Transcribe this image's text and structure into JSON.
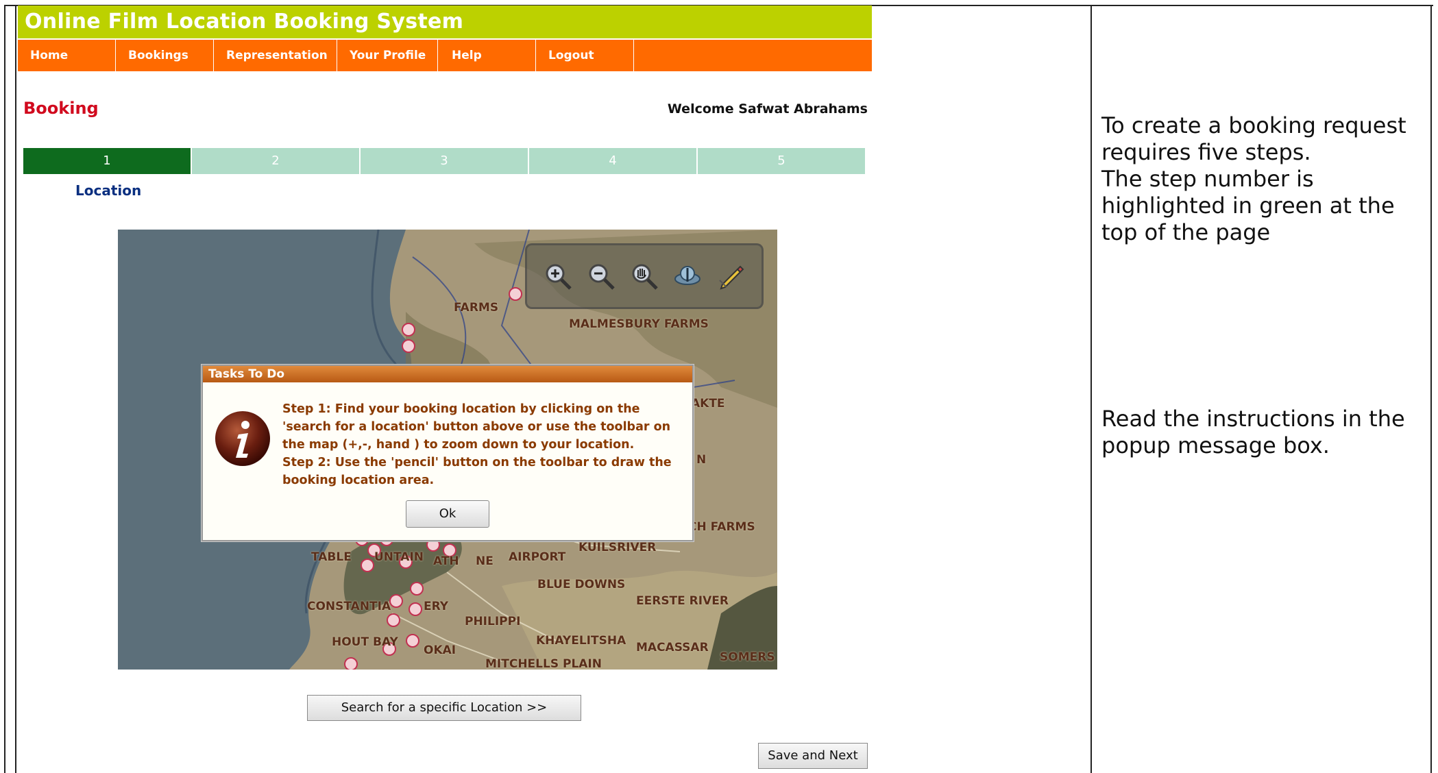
{
  "app": {
    "title": "Online Film Location Booking System",
    "nav": [
      "Home",
      "Bookings",
      "Representation",
      "Your Profile",
      "Help",
      "Logout"
    ],
    "page_heading": "Booking",
    "welcome": "Welcome Safwat Abrahams",
    "steps": [
      "1",
      "2",
      "3",
      "4",
      "5"
    ],
    "active_step": "1",
    "step_label": "Location"
  },
  "map": {
    "toolbar_icons": [
      "zoom-in-icon",
      "zoom-out-icon",
      "pan-hand-icon",
      "full-extent-globe-icon",
      "pencil-draw-icon"
    ],
    "labels": [
      "FARMS",
      "MALMESBURY FARMS",
      "AKTE",
      "N",
      "CH FARMS",
      "KUILSRIVER",
      "TABLE",
      "UNTAIN",
      "ATH",
      "NE",
      "AIRPORT",
      "BLUE DOWNS",
      "CONSTANTIA",
      "ERY",
      "EERSTE RIVER",
      "PHILIPPI",
      "KHAYELITSHA",
      "MACASSAR",
      "HOUT BAY",
      "OKAI",
      "MITCHELLS PLAIN",
      "SOMERS"
    ]
  },
  "popup": {
    "title": "Tasks To Do",
    "message_lines": [
      "Step 1: Find your booking location by clicking on the",
      "'search for a location' button above or use the toolbar on",
      "the map (+,-, hand ) to zoom down to your location.",
      "Step 2: Use the 'pencil' button on the toolbar to draw the",
      "booking location area."
    ],
    "ok_label": "Ok"
  },
  "buttons": {
    "search_label": "Search for a specific Location >>",
    "save_label": "Save and Next"
  },
  "notes": {
    "note1": "To create a booking request requires five steps.\nThe step number is highlighted in green at the top of the page",
    "note2": "Read the instructions in the popup message box."
  },
  "colors": {
    "title_bar": "#bcd100",
    "nav_bar": "#ff6a00",
    "active_step": "#0e6b1e",
    "inactive_step": "#b0dcc8",
    "heading": "#d10a1e"
  }
}
